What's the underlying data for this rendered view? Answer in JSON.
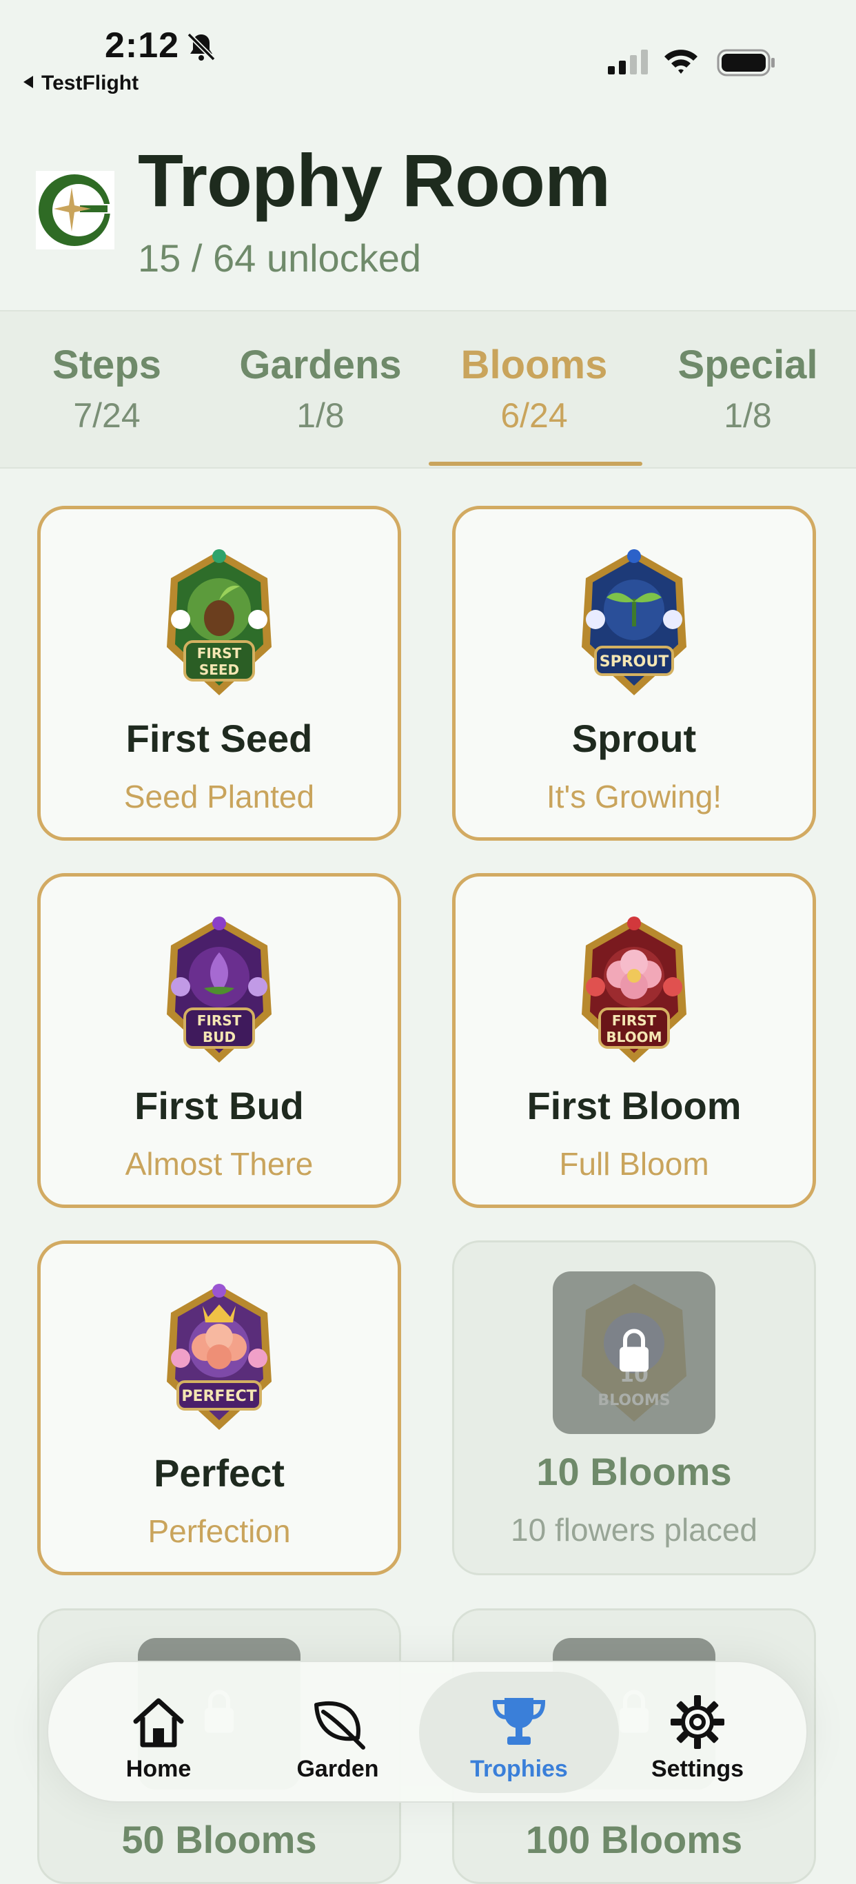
{
  "status": {
    "time": "2:12",
    "back_app": "TestFlight"
  },
  "header": {
    "title": "Trophy Room",
    "subtitle": "15 / 64 unlocked"
  },
  "tabs": [
    {
      "name": "Steps",
      "count": "7/24"
    },
    {
      "name": "Gardens",
      "count": "1/8"
    },
    {
      "name": "Blooms",
      "count": "6/24",
      "active": true
    },
    {
      "name": "Special",
      "count": "1/8"
    }
  ],
  "trophies": [
    {
      "title": "First Seed",
      "subtitle": "Seed Planted",
      "badge_text": [
        "FIRST",
        "SEED"
      ],
      "locked": false
    },
    {
      "title": "Sprout",
      "subtitle": "It's Growing!",
      "badge_text": [
        "SPROUT"
      ],
      "locked": false
    },
    {
      "title": "First Bud",
      "subtitle": "Almost There",
      "badge_text": [
        "FIRST",
        "BUD"
      ],
      "locked": false
    },
    {
      "title": "First Bloom",
      "subtitle": "Full Bloom",
      "badge_text": [
        "FIRST",
        "BLOOM"
      ],
      "locked": false
    },
    {
      "title": "Perfect",
      "subtitle": "Perfection",
      "badge_text": [
        "PERFECT"
      ],
      "locked": false
    },
    {
      "title": "10 Blooms",
      "subtitle": "10 flowers placed",
      "badge_text": [
        "10",
        "BLOOMS"
      ],
      "locked": true
    },
    {
      "title": "50 Blooms",
      "subtitle": "",
      "locked": true
    },
    {
      "title": "100 Blooms",
      "subtitle": "",
      "locked": true
    }
  ],
  "nav": [
    {
      "label": "Home",
      "icon": "home-icon"
    },
    {
      "label": "Garden",
      "icon": "leaf-icon"
    },
    {
      "label": "Trophies",
      "icon": "trophy-icon",
      "active": true
    },
    {
      "label": "Settings",
      "icon": "gear-icon"
    }
  ],
  "colors": {
    "accent_gold": "#c9a45c",
    "muted_green": "#6f8a6a",
    "active_blue": "#3a7fd9",
    "background": "#eff4ef"
  }
}
